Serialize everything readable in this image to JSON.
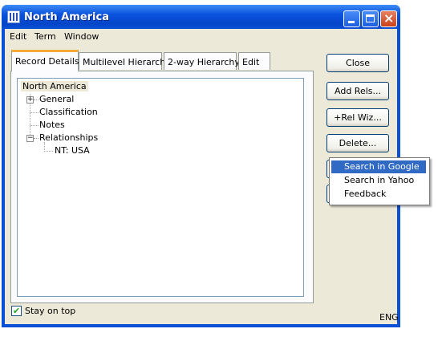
{
  "window": {
    "title": "North America"
  },
  "menu": [
    "Edit",
    "Term",
    "Window"
  ],
  "tabs": [
    "Record Details",
    "Multilevel Hierarchy",
    "2-way Hierarchy",
    "Edit"
  ],
  "tree": {
    "root": "North America",
    "nodes": [
      "General",
      "Classification",
      "Notes",
      "Relationships",
      "NT: USA"
    ],
    "expanders": [
      "+",
      "−"
    ]
  },
  "buttons": [
    "Close",
    "Add Rels...",
    "+Rel Wiz...",
    "Delete..."
  ],
  "popup": [
    "Search in Google",
    "Search in Yahoo",
    "Feedback"
  ],
  "footer": {
    "stay_on_top": "Stay on top",
    "check_glyph": "✔",
    "lang": "ENG"
  }
}
